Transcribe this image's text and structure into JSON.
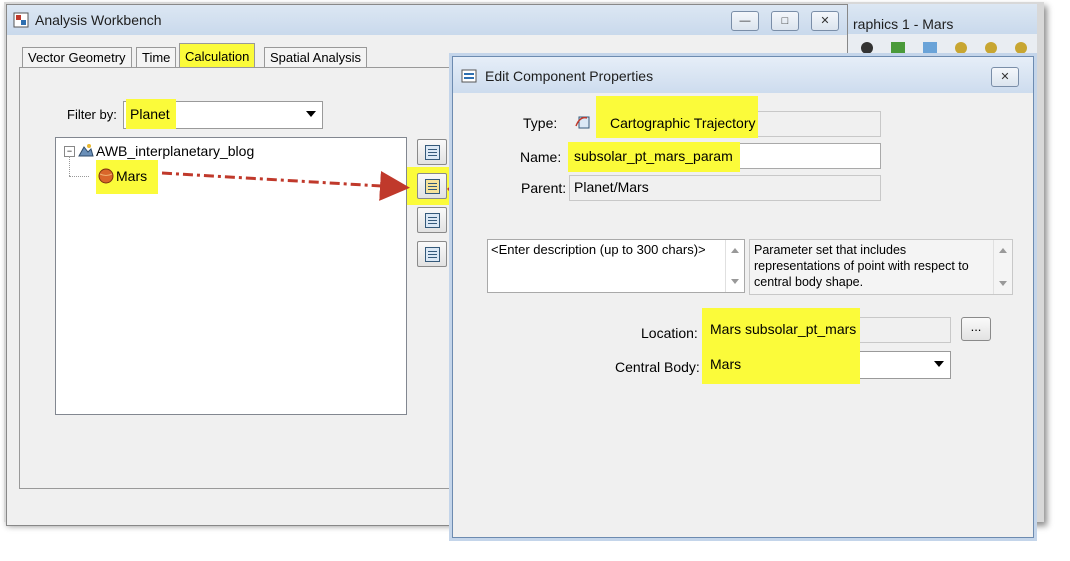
{
  "main_window": {
    "title": "Analysis Workbench",
    "tabs": [
      "Vector Geometry",
      "Time",
      "Calculation",
      "Spatial Analysis"
    ],
    "active_tab": "Calculation",
    "filter_label": "Filter by:",
    "filter_value": "Planet",
    "tree": {
      "root": "AWB_interplanetary_blog",
      "child": "Mars"
    }
  },
  "background_window": {
    "title": "raphics 1 - Mars"
  },
  "dialog": {
    "title": "Edit Component Properties",
    "type_label": "Type:",
    "type_value": "Cartographic Trajectory",
    "name_label": "Name:",
    "name_value": "subsolar_pt_mars_param",
    "parent_label": "Parent:",
    "parent_value": "Planet/Mars",
    "description_placeholder": "<Enter description (up to 300 chars)>",
    "info_text": "Parameter set that includes representations of point with respect to central body shape.",
    "location_label": "Location:",
    "location_value": "Mars subsolar_pt_mars",
    "browse_label": "...",
    "central_body_label": "Central Body:",
    "central_body_value": "Mars"
  },
  "colors": {
    "highlight": "#fbfb3a",
    "annotation_arrow": "#c0392b",
    "title_bar": "#cddcee"
  }
}
